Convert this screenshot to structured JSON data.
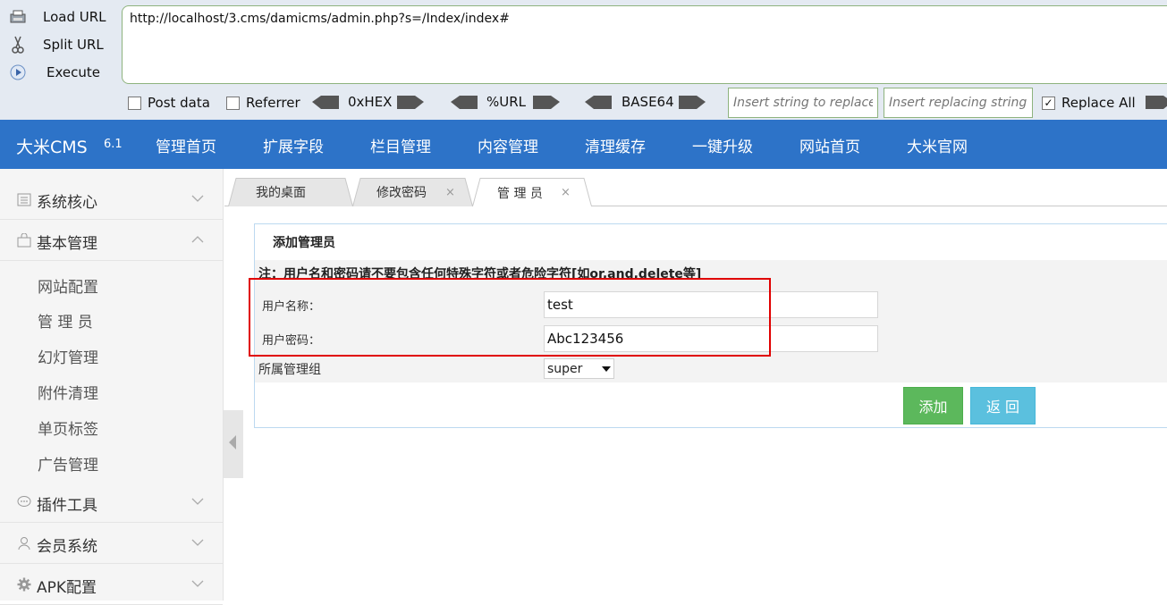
{
  "hackbar": {
    "load_url": "Load URL",
    "split_url": "Split URL",
    "execute": "Execute",
    "url_value": "http://localhost/3.cms/damicms/admin.php?s=/Index/index#",
    "post_data": "Post data",
    "referrer": "Referrer",
    "hex": "0xHEX",
    "urlenc": "%URL",
    "base64": "BASE64",
    "replace_placeholder": "Insert string to replace",
    "replacing_placeholder": "Insert replacing string",
    "replace_all": "Replace All",
    "accent": "#8eb37e"
  },
  "nav": {
    "brand": "大米CMS",
    "version": "6.1",
    "items": [
      "管理首页",
      "扩展字段",
      "栏目管理",
      "内容管理",
      "清理缓存",
      "一键升级",
      "网站首页",
      "大米官网"
    ],
    "bg": "#2d73c8"
  },
  "sidebar": {
    "groups": [
      "系统核心",
      "基本管理",
      "插件工具",
      "会员系统",
      "APK配置"
    ],
    "subitems": [
      "网站配置",
      "管 理 员",
      "幻灯管理",
      "附件清理",
      "单页标签",
      "广告管理"
    ]
  },
  "tabs": [
    {
      "label": "我的桌面"
    },
    {
      "label": "修改密码",
      "close": "×"
    },
    {
      "label": "管 理 员",
      "close": "×"
    }
  ],
  "form": {
    "title": "添加管理员",
    "note": "注：用户名和密码请不要包含任何特殊字符或者危险字符[如or,and,delete等]",
    "username_label": "用户名称：",
    "username_value": "test",
    "password_label": "用户密码：",
    "password_value": "Abc123456",
    "group_label": "所属管理组",
    "group_value": "super",
    "add_button": "添加",
    "back_button": "返 回"
  }
}
